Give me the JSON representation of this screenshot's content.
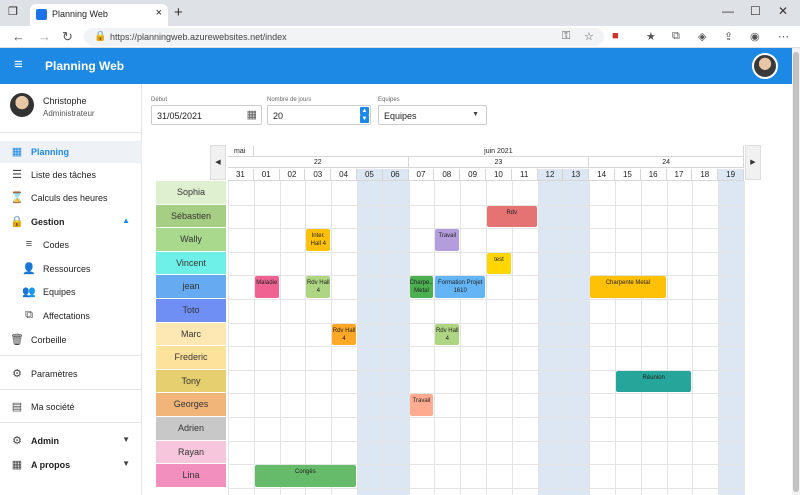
{
  "browser": {
    "tab_title": "Planning Web",
    "url": "https://planningweb.azurewebsites.net/index"
  },
  "app": {
    "title": "Planning Web"
  },
  "user": {
    "name": "Christophe",
    "role": "Administrateur"
  },
  "sidebar": {
    "items": [
      {
        "label": "Planning",
        "icon": "calendar-icon"
      },
      {
        "label": "Liste des tâches",
        "icon": "list-icon"
      },
      {
        "label": "Calculs des heures",
        "icon": "hourglass-icon"
      },
      {
        "label": "Gestion",
        "icon": "lock-icon"
      },
      {
        "label": "Codes",
        "icon": "playlist-add-icon"
      },
      {
        "label": "Ressources",
        "icon": "person-icon"
      },
      {
        "label": "Equipes",
        "icon": "group-icon"
      },
      {
        "label": "Affectations",
        "icon": "copy-icon"
      },
      {
        "label": "Corbeille",
        "icon": "trash-icon"
      },
      {
        "label": "Paramètres",
        "icon": "gear-icon"
      },
      {
        "label": "Ma société",
        "icon": "building-icon"
      },
      {
        "label": "Admin",
        "icon": "admin-icon"
      },
      {
        "label": "A propos",
        "icon": "grid-icon"
      }
    ]
  },
  "filters": {
    "start_label": "Début",
    "start_value": "31/05/2021",
    "days_label": "Nombre de jours",
    "days_value": "20",
    "team_label": "Equipes",
    "team_value": "Equipes"
  },
  "planning": {
    "months": [
      {
        "label": "mai"
      },
      {
        "label": "juin 2021"
      }
    ],
    "weeks": [
      {
        "label": "22"
      },
      {
        "label": "23"
      },
      {
        "label": "24"
      }
    ],
    "days": [
      "31",
      "01",
      "02",
      "03",
      "04",
      "05",
      "06",
      "07",
      "08",
      "09",
      "10",
      "11",
      "12",
      "13",
      "14",
      "15",
      "16",
      "17",
      "18",
      "19"
    ],
    "weekend_days": [
      "05",
      "06",
      "12",
      "13",
      "19"
    ],
    "resources": [
      {
        "name": "Sophia",
        "color": "#dff0d0"
      },
      {
        "name": "Sébastien",
        "color": "#a6cf85"
      },
      {
        "name": "Wally",
        "color": "#a9d98c"
      },
      {
        "name": "Vincent",
        "color": "#6ef0e8"
      },
      {
        "name": "jean",
        "color": "#66aaf2"
      },
      {
        "name": "Toto",
        "color": "#6f8ff5"
      },
      {
        "name": "Marc",
        "color": "#fde8b4"
      },
      {
        "name": "Frederic",
        "color": "#fde29c"
      },
      {
        "name": "Tony",
        "color": "#e6cf6e"
      },
      {
        "name": "Georges",
        "color": "#f1b57a"
      },
      {
        "name": "Adrien",
        "color": "#c8c8c8"
      },
      {
        "name": "Rayan",
        "color": "#f6c6dd"
      },
      {
        "name": "Lina",
        "color": "#f28fbf"
      }
    ],
    "events": [
      {
        "text": "Rdv",
        "row": 1,
        "start": 10,
        "span": 2,
        "color": "#e57373"
      },
      {
        "text": "Inter. Hall 4",
        "row": 2,
        "start": 3,
        "span": 1,
        "color": "#ffc107"
      },
      {
        "text": "Travail",
        "row": 2,
        "start": 8,
        "span": 1,
        "color": "#b39ddb"
      },
      {
        "text": "test",
        "row": 3,
        "start": 10,
        "span": 1,
        "color": "#ffd600"
      },
      {
        "text": "Maladie",
        "row": 4,
        "start": 1,
        "span": 1,
        "color": "#f06292"
      },
      {
        "text": "Rdv Hall 4",
        "row": 4,
        "start": 3,
        "span": 1,
        "color": "#aed581"
      },
      {
        "text": "Charpe... Metal",
        "row": 4,
        "start": 7,
        "span": 1,
        "color": "#4caf50"
      },
      {
        "text": "Formation Projet 1610",
        "row": 4,
        "start": 8,
        "span": 2,
        "color": "#64b5f6"
      },
      {
        "text": "Charpente Metal",
        "row": 4,
        "start": 14,
        "span": 3,
        "color": "#ffc107"
      },
      {
        "text": "Rdv Hall 4",
        "row": 6,
        "start": 4,
        "span": 1,
        "color": "#ffa726"
      },
      {
        "text": "Rdv Hall 4",
        "row": 6,
        "start": 8,
        "span": 1,
        "color": "#aed581"
      },
      {
        "text": "Réunion",
        "row": 8,
        "start": 15,
        "span": 3,
        "color": "#26a69a"
      },
      {
        "text": "Travail",
        "row": 9,
        "start": 7,
        "span": 1,
        "color": "#ffab91"
      },
      {
        "text": "Congés",
        "row": 12,
        "start": 1,
        "span": 4,
        "color": "#66bb6a"
      }
    ]
  }
}
